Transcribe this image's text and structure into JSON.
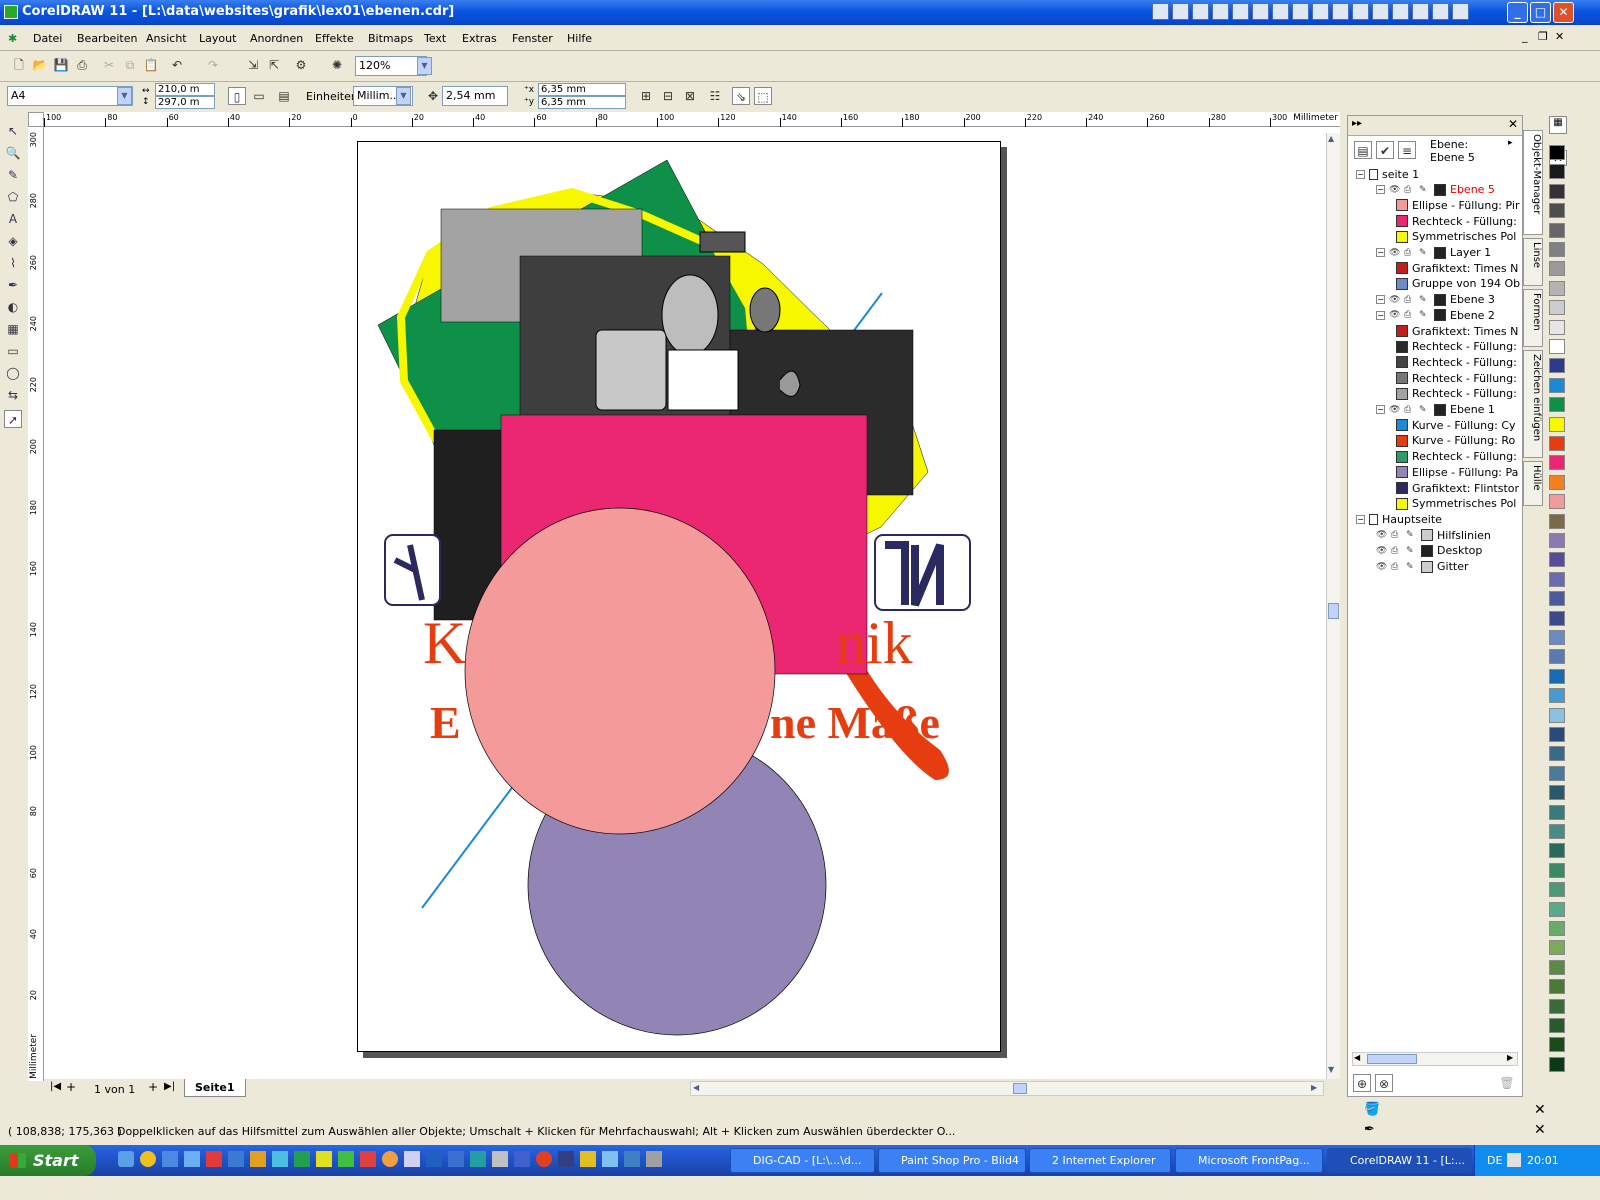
{
  "window": {
    "title": "CorelDRAW 11 - [L:\\data\\websites\\grafik\\lex01\\ebenen.cdr]",
    "min": "_",
    "max": "□",
    "close": "✕"
  },
  "menu": [
    "Datei",
    "Bearbeiten",
    "Ansicht",
    "Layout",
    "Anordnen",
    "Effekte",
    "Bitmaps",
    "Text",
    "Extras",
    "Fenster",
    "Hilfe"
  ],
  "toolbar": {
    "zoom": "120%"
  },
  "propbar": {
    "paper": "A4",
    "width": "210,0 m",
    "height": "297,0 m",
    "units_label": "Einheiten:",
    "units_value": "Millim...",
    "nudge": "2,54 mm",
    "dup_x": "6,35 mm",
    "dup_y": "6,35 mm"
  },
  "ruler": {
    "unit": "Millimeter",
    "h_labels": [
      "100",
      "80",
      "60",
      "40",
      "20",
      "0",
      "20",
      "40",
      "60",
      "80",
      "100",
      "120",
      "140",
      "160",
      "180",
      "200",
      "220",
      "240",
      "260",
      "280",
      "300"
    ],
    "v_labels": [
      "300",
      "280",
      "260",
      "240",
      "220",
      "200",
      "180",
      "160",
      "140",
      "120",
      "100",
      "80",
      "60",
      "40",
      "20"
    ]
  },
  "artwork": {
    "text_line1_a": "K",
    "text_line1_b": "nik",
    "text_line2_a": "E",
    "text_line2_b": "ne Maße",
    "colors": {
      "green": "#0f9048",
      "gray": "#a3a3a3",
      "dark": "#3e3e3e",
      "black": "#1f1f1f",
      "magenta": "#ea2770",
      "salmon": "#f59a9a",
      "lavender": "#9384b6",
      "yellow": "#f7f700",
      "orange": "#e53c10",
      "blue": "#1a8ad8"
    }
  },
  "pagetabs": {
    "counter": "1 von 1",
    "tab": "Seite1"
  },
  "docker": {
    "layer_label": "Ebene:",
    "layer_value": "Ebene 5",
    "tree": [
      {
        "label": "seite 1",
        "indent": 0,
        "kind": "page"
      },
      {
        "label": "Ebene 5",
        "indent": 1,
        "kind": "layer",
        "active": true
      },
      {
        "label": "Ellipse - Füllung: Pir",
        "indent": 2,
        "kind": "obj",
        "sw": "#f59a9a"
      },
      {
        "label": "Rechteck - Füllung:",
        "indent": 2,
        "kind": "obj",
        "sw": "#ea2770"
      },
      {
        "label": "Symmetrisches Pol",
        "indent": 2,
        "kind": "obj",
        "sw": "#f7f700"
      },
      {
        "label": "Layer 1",
        "indent": 1,
        "kind": "layer"
      },
      {
        "label": "Grafiktext: Times N",
        "indent": 2,
        "kind": "obj",
        "sw": "#c21e1e"
      },
      {
        "label": "Gruppe von 194 Ob",
        "indent": 2,
        "kind": "obj",
        "sw": "#6b8cc8"
      },
      {
        "label": "Ebene 3",
        "indent": 1,
        "kind": "layer"
      },
      {
        "label": "Ebene 2",
        "indent": 1,
        "kind": "layer"
      },
      {
        "label": "Grafiktext: Times N",
        "indent": 2,
        "kind": "obj",
        "sw": "#c21e1e"
      },
      {
        "label": "Rechteck - Füllung:",
        "indent": 2,
        "kind": "obj",
        "sw": "#2a2a2a"
      },
      {
        "label": "Rechteck - Füllung:",
        "indent": 2,
        "kind": "obj",
        "sw": "#444444"
      },
      {
        "label": "Rechteck - Füllung:",
        "indent": 2,
        "kind": "obj",
        "sw": "#777777"
      },
      {
        "label": "Rechteck - Füllung:",
        "indent": 2,
        "kind": "obj",
        "sw": "#a3a3a3"
      },
      {
        "label": "Ebene 1",
        "indent": 1,
        "kind": "layer"
      },
      {
        "label": "Kurve - Füllung: Cy",
        "indent": 2,
        "kind": "obj",
        "sw": "#1a8ad8"
      },
      {
        "label": "Kurve - Füllung: Ro",
        "indent": 2,
        "kind": "obj",
        "sw": "#e53c10"
      },
      {
        "label": "Rechteck - Füllung:",
        "indent": 2,
        "kind": "obj",
        "sw": "#2e9a6a"
      },
      {
        "label": "Ellipse - Füllung: Pa",
        "indent": 2,
        "kind": "obj",
        "sw": "#9384b6"
      },
      {
        "label": "Grafiktext: Flintstor",
        "indent": 2,
        "kind": "obj",
        "sw": "#2a2a60"
      },
      {
        "label": "Symmetrisches Pol",
        "indent": 2,
        "kind": "obj",
        "sw": "#f7f700"
      },
      {
        "label": "Hauptseite",
        "indent": 0,
        "kind": "page"
      },
      {
        "label": "Hilfslinien",
        "indent": 1,
        "kind": "master",
        "sw": "#cccccc"
      },
      {
        "label": "Desktop",
        "indent": 1,
        "kind": "master",
        "sw": "#222222"
      },
      {
        "label": "Gitter",
        "indent": 1,
        "kind": "master",
        "sw": "#cccccc"
      }
    ]
  },
  "sidetabs": [
    "Objekt-Manager",
    "Linse",
    "Formen",
    "Zeichen einfügen",
    "Hülle"
  ],
  "palette": [
    "#000000",
    "#1a1a1a",
    "#333333",
    "#4d4d4d",
    "#666666",
    "#808080",
    "#999999",
    "#b3b3b3",
    "#cccccc",
    "#e6e6e6",
    "#ffffff",
    "#2e3a8c",
    "#1a8ad8",
    "#0f9048",
    "#f7f700",
    "#e53c10",
    "#ea2770",
    "#f08020",
    "#f59a9a",
    "#7a6a4a",
    "#8a7ab0",
    "#5a4a9a",
    "#6a6ab0",
    "#4a5a9a",
    "#3a4a8a",
    "#6a8ac0",
    "#5a7ab0",
    "#1a6ab0",
    "#4a9ad0",
    "#8ac0e0",
    "#2a4a7a",
    "#3a6a8a",
    "#4a7a9a",
    "#2a5a6a",
    "#3a7a7a",
    "#4a8a8a",
    "#2a6a5a",
    "#3a8a6a",
    "#4a9a7a",
    "#5aaa8a",
    "#6aaa6a",
    "#7aaa5a",
    "#5a8a4a",
    "#4a7a3a",
    "#3a6a3a",
    "#2a5a2a",
    "#1a4a1a",
    "#0a3a1a"
  ],
  "status": {
    "coords": "( 108,838; 175,363 )",
    "hint": "Doppelklicken auf das Hilfsmittel zum Auswählen aller Objekte; Umschalt + Klicken für Mehrfachauswahl; Alt + Klicken zum Auswählen überdeckter O..."
  },
  "taskbar": {
    "start": "Start",
    "tasks": [
      "DIG-CAD - [L:\\...\\d...",
      "Paint Shop Pro - Bild4",
      "2 Internet Explorer",
      "Microsoft FrontPag...",
      "CorelDRAW 11 - [L:..."
    ],
    "lang": "DE",
    "clock": "20:01"
  }
}
